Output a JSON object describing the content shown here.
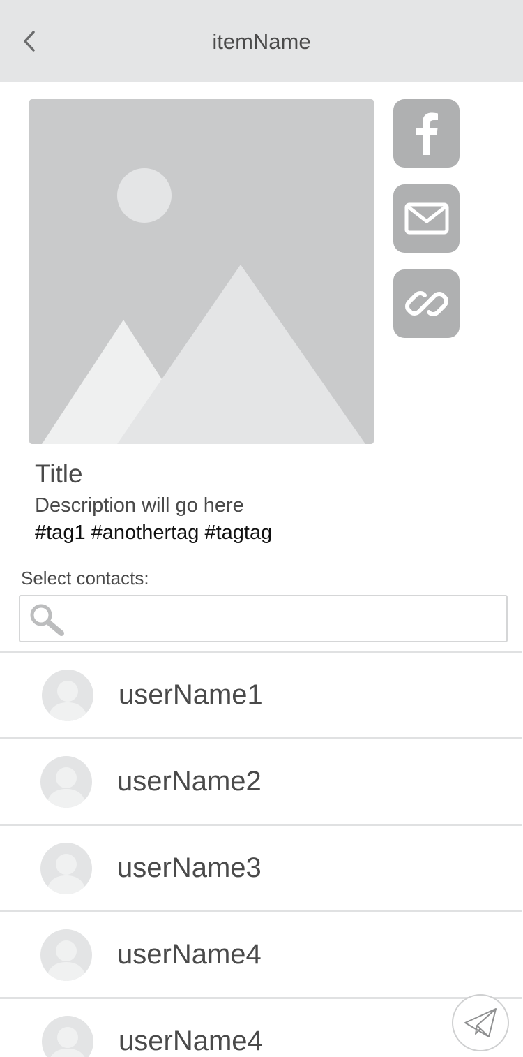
{
  "header": {
    "title": "itemName",
    "back_icon": "chevron-left-icon"
  },
  "item": {
    "image_icon": "image-placeholder-icon",
    "title": "Title",
    "description": "Description will go here",
    "tags": "#tag1 #anothertag #tagtag"
  },
  "share": [
    {
      "icon": "facebook-icon"
    },
    {
      "icon": "mail-icon"
    },
    {
      "icon": "link-icon"
    }
  ],
  "contacts": {
    "label": "Select contacts:",
    "search_icon": "search-icon",
    "search_value": "",
    "items": [
      {
        "name": "userName1"
      },
      {
        "name": "userName2"
      },
      {
        "name": "userName3"
      },
      {
        "name": "userName4"
      },
      {
        "name": "userName4"
      }
    ]
  },
  "send": {
    "icon": "paper-plane-icon"
  },
  "colors": {
    "header_bg": "#e4e5e6",
    "share_button": "#afb0b1",
    "image_bg": "#c9cacb",
    "divider": "#e0e1e2",
    "text": "#4a4a4a"
  }
}
